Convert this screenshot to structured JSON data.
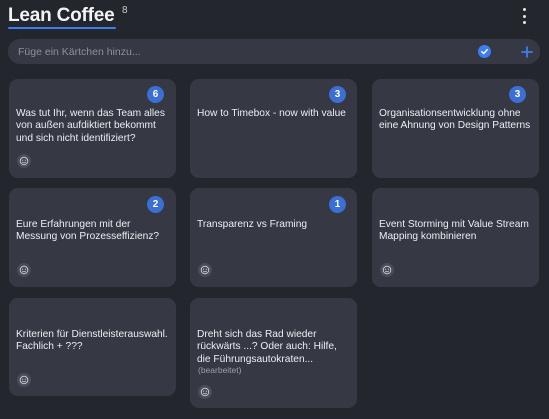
{
  "header": {
    "title": "Lean Coffee",
    "card_count": "8",
    "menu_icon": "kebab-menu-icon"
  },
  "add_card": {
    "placeholder": "Füge ein Kärtchen hinzu...",
    "value": "",
    "confirm_icon": "check-circle-icon",
    "add_icon": "plus-icon"
  },
  "colors": {
    "background": "#24262d",
    "card": "#363943",
    "accent": "#3d7df2",
    "badge": "#3b6fd4"
  },
  "cards": [
    {
      "text": "Was tut Ihr, wenn das Team alles von außen aufdiktiert bekommt und sich nicht identifiziert?",
      "votes": "6",
      "edited": ""
    },
    {
      "text": "How to Timebox - now with value",
      "votes": "3",
      "edited": ""
    },
    {
      "text": "Organisationsentwicklung ohne eine Ahnung von Design Patterns",
      "votes": "3",
      "edited": ""
    },
    {
      "text": "Eure Erfahrungen mit der Messung von Prozesseffizienz?",
      "votes": "2",
      "edited": ""
    },
    {
      "text": "Transparenz vs Framing",
      "votes": "1",
      "edited": ""
    },
    {
      "text": "Event Storming mit Value Stream Mapping kombinieren",
      "votes": "",
      "edited": ""
    },
    {
      "text": "Kriterien für Dienstleisterauswahl. Fachlich + ???",
      "votes": "",
      "edited": ""
    },
    {
      "text": "Dreht sich das Rad wieder rückwärts ...? Oder auch: Hilfe, die Führungsautokraten...",
      "votes": "",
      "edited": "(bearbeitet)"
    }
  ]
}
